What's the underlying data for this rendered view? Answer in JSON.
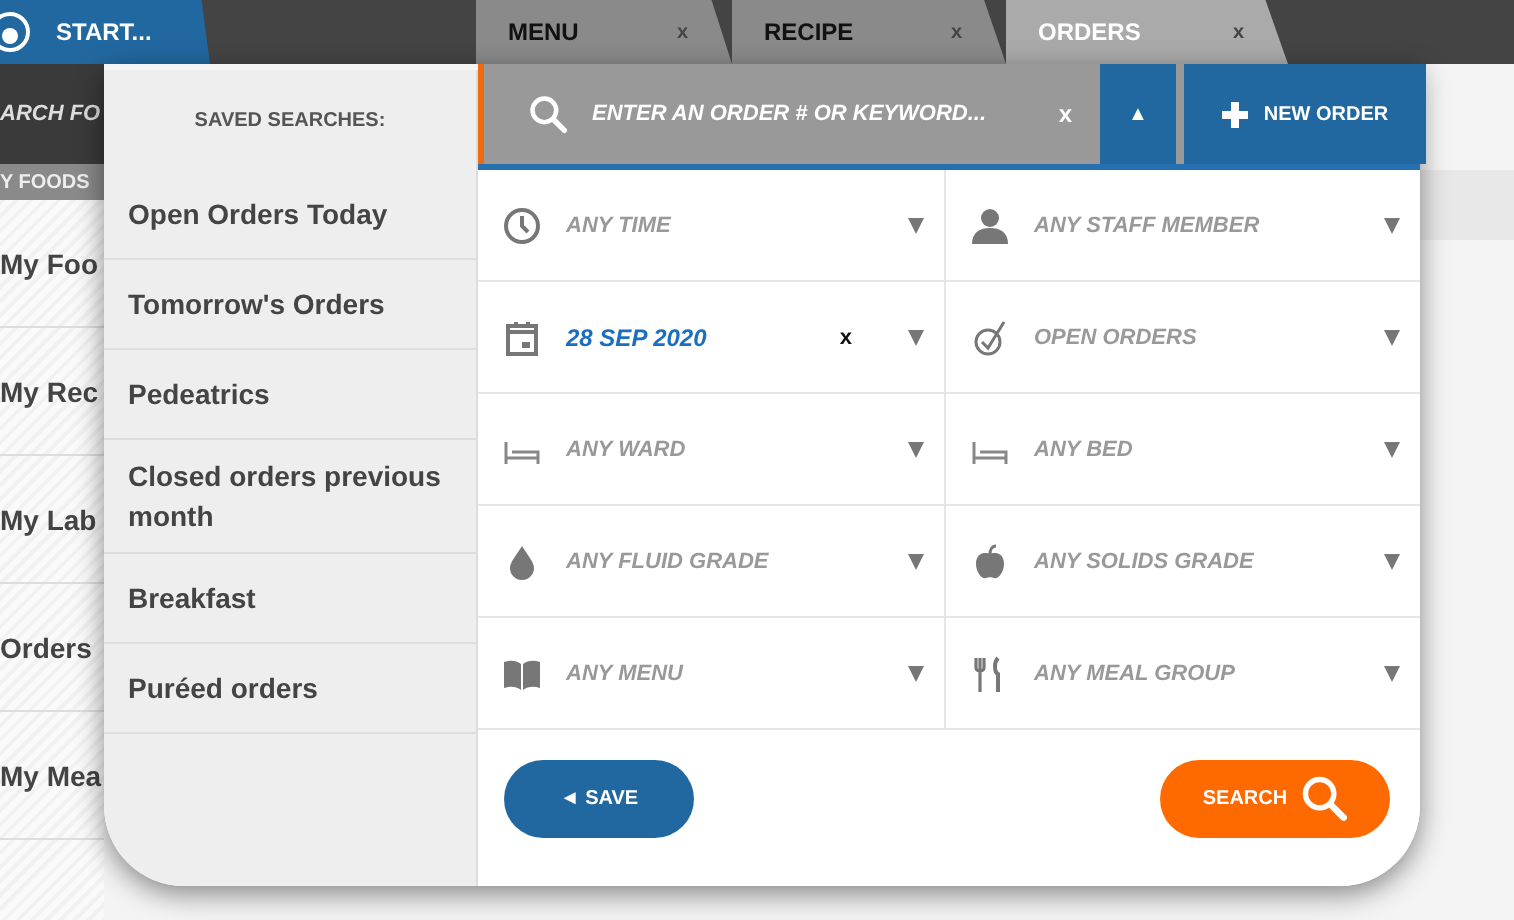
{
  "start_tab": {
    "label": "START..."
  },
  "tabs": [
    {
      "label": "MENU",
      "close": "x",
      "selected": false
    },
    {
      "label": "RECIPE",
      "close": "x",
      "selected": false
    },
    {
      "label": "ORDERS",
      "close": "x",
      "selected": true
    }
  ],
  "sidebar": {
    "search_text": "ARCH FO",
    "header": "Y FOODS",
    "items": [
      "My Foo",
      "My Rec",
      "My Lab",
      "Orders",
      "My Mea"
    ]
  },
  "saved_searches": {
    "title": "SAVED SEARCHES:",
    "items": [
      "Open Orders Today",
      "Tomorrow's Orders",
      "Pedeatrics",
      "Closed orders previous month",
      "Breakfast",
      "Puréed orders"
    ]
  },
  "search": {
    "placeholder": "ENTER AN ORDER # OR KEYWORD...",
    "clear": "x",
    "toggle": "▲"
  },
  "new_order": {
    "label": "NEW ORDER"
  },
  "filters": [
    {
      "kind": "time",
      "placeholder": "ANY TIME"
    },
    {
      "kind": "staff",
      "placeholder": "ANY STAFF MEMBER"
    },
    {
      "kind": "date",
      "value": "28 SEP 2020",
      "clear": "x"
    },
    {
      "kind": "status",
      "placeholder": "OPEN ORDERS"
    },
    {
      "kind": "ward",
      "placeholder": "ANY WARD"
    },
    {
      "kind": "bed",
      "placeholder": "ANY BED"
    },
    {
      "kind": "fluid",
      "placeholder": "ANY FLUID GRADE"
    },
    {
      "kind": "solids",
      "placeholder": "ANY SOLIDS GRADE"
    },
    {
      "kind": "menu",
      "placeholder": "ANY MENU"
    },
    {
      "kind": "mealgroup",
      "placeholder": "ANY MEAL GROUP"
    }
  ],
  "save_button": {
    "arrow": "◄",
    "label": "SAVE"
  },
  "search_button": {
    "label": "SEARCH"
  }
}
